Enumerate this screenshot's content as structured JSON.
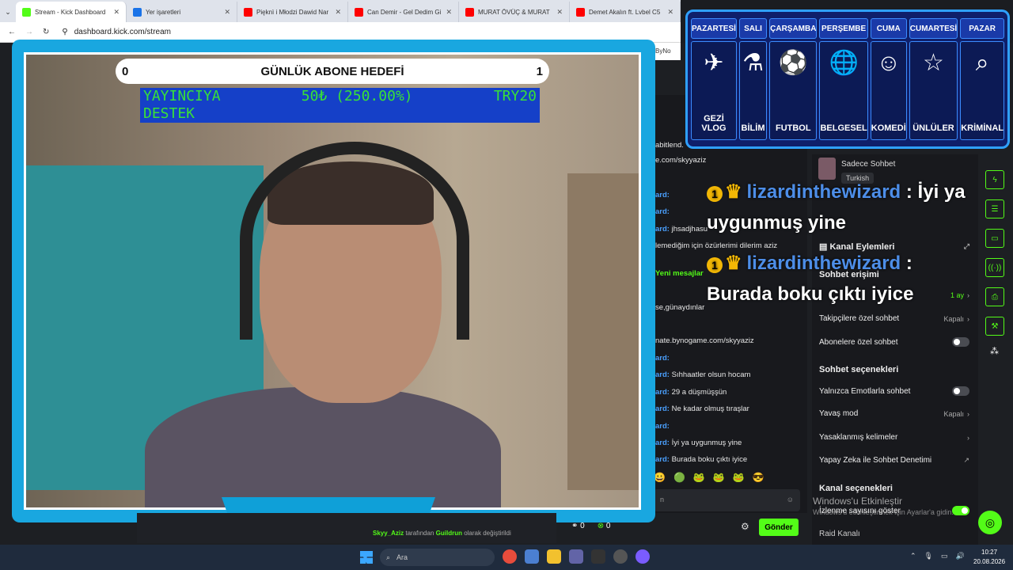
{
  "browser": {
    "tabs": [
      {
        "title": "Stream - Kick Dashboard",
        "color": "#53fc18",
        "active": true
      },
      {
        "title": "Yer işaretleri",
        "color": "#1a73e8",
        "active": false
      },
      {
        "title": "Pięknì i Młodzi Dawid Nar",
        "color": "#ff0000",
        "active": false
      },
      {
        "title": "Can Demir - Gel Dedim Gi",
        "color": "#ff0000",
        "active": false
      },
      {
        "title": "MURAT ÖVÜÇ & MURAT",
        "color": "#ff0000",
        "active": false
      },
      {
        "title": "Demet Akalın ft. Lvbel C5",
        "color": "#ff0000",
        "active": false
      }
    ],
    "url": "dashboard.kick.com/stream",
    "bookmark_clip": "ByNo"
  },
  "schedule": {
    "days": [
      {
        "name": "PAZARTESİ",
        "label": "GEZİ\nVLOG",
        "icon": "globe-plane-icon",
        "glyph": "✈"
      },
      {
        "name": "SALI",
        "label": "BİLİM",
        "icon": "flask-icon",
        "glyph": "⚗"
      },
      {
        "name": "ÇARŞAMBA",
        "label": "FUTBOL",
        "icon": "football-icon",
        "glyph": "⚽"
      },
      {
        "name": "PERŞEMBE",
        "label": "BELGESEL",
        "icon": "globe-icon",
        "glyph": "🌐"
      },
      {
        "name": "CUMA",
        "label": "KOMEDİ",
        "icon": "comedy-mask-icon",
        "glyph": "☺"
      },
      {
        "name": "CUMARTESİ",
        "label": "ÜNLÜLER",
        "icon": "star-icon",
        "glyph": "☆"
      },
      {
        "name": "PAZAR",
        "label": "KRİMİNAL",
        "icon": "fingerprint-search-icon",
        "glyph": "⌕"
      }
    ]
  },
  "stream": {
    "goal_left": "0",
    "goal_title": "GÜNLÜK ABONE HEDEFİ",
    "goal_right": "1",
    "donate_line1_a": "YAYINCIYA",
    "donate_line1_b": "50₺ (250.00%)",
    "donate_line1_c": "TRY20",
    "donate_line2": "DESTEK"
  },
  "overlay_chat": [
    {
      "badge": "1",
      "user": "lizardinthewizard",
      "sep": " : ",
      "text": "İyi ya"
    },
    {
      "text": "uygunmuş yine"
    },
    {
      "badge": "1",
      "user": "lizardinthewizard",
      "sep": " :",
      "text": ""
    },
    {
      "text": "Burada boku çıktı iyice"
    }
  ],
  "chat": {
    "lines": [
      {
        "u": "",
        "t": "abitlend."
      },
      {
        "u": "",
        "t": "e.com/skyyaziz"
      },
      {
        "u": "ard:",
        "t": ""
      },
      {
        "u": "ard:",
        "t": ""
      },
      {
        "u": "ard:",
        "t": "jhsadjhasu"
      },
      {
        "u": "",
        "t": "lemediğim için özürlerimi dilerim aziz"
      },
      {
        "u": "",
        "t": "Yeni mesajlar"
      },
      {
        "u": "",
        "t": "se,günaydınlar"
      },
      {
        "u": "",
        "t": "nate.bynogame.com/skyyaziz"
      },
      {
        "u": "ard:",
        "t": ""
      },
      {
        "u": "ard:",
        "t": "Sıhhaatler olsun hocam"
      },
      {
        "u": "ard:",
        "t": "29 a düşmüşşün"
      },
      {
        "u": "ard:",
        "t": "Ne kadar olmuş tıraşlar"
      },
      {
        "u": "ard:",
        "t": ""
      },
      {
        "u": "ard:",
        "t": "İyi ya uygunmuş yine"
      },
      {
        "u": "ard:",
        "t": "Burada boku çıktı iyice"
      }
    ],
    "input_placeholder": "n",
    "send_label": "Gönder",
    "viewer_count": "0",
    "other_count": "0"
  },
  "panel": {
    "user_label": "Sadece Sohbet",
    "language": "Turkish",
    "title": "Kanal Eylemleri",
    "section_access": "Sohbet erişimi",
    "rows": [
      {
        "label": "",
        "value": "1 ay",
        "type": "chevron"
      },
      {
        "label": "Takipçilere özel sohbet",
        "value": "Kapalı",
        "type": "chevron"
      },
      {
        "label": "Abonelere özel sohbet",
        "type": "toggle",
        "on": false
      }
    ],
    "section_options": "Sohbet seçenekleri",
    "rows2": [
      {
        "label": "Yalnızca Emotlarla sohbet",
        "type": "toggle",
        "on": false
      },
      {
        "label": "Yavaş mod",
        "value": "Kapalı",
        "type": "chevron"
      },
      {
        "label": "Yasaklanmış kelimeler",
        "type": "chevron"
      },
      {
        "label": "Yapay Zeka ile Sohbet Denetimi",
        "type": "external"
      }
    ],
    "section_channel": "Kanal seçenekleri",
    "viewer_count_label": "İzlenme sayısını göster",
    "raid": "Raid Kanalı"
  },
  "windows_watermark": "Windows'u Etkinleştir",
  "windows_watermark_sub": "Windows'u etkinleştirmek için Ayarlar'a gidin.",
  "changed_by_user": "Skyy_Aziz",
  "changed_middle": "tarafından",
  "changed_by_other": "Guildrun",
  "changed_suffix": "olarak değiştirildi",
  "taskbar": {
    "search": "Ara",
    "time": "10:27",
    "date": "20.08.2026"
  },
  "colors": {
    "kick_green": "#53fc18",
    "frame_blue": "#19a7e0",
    "schedule_bg": "#0f1f6a"
  }
}
